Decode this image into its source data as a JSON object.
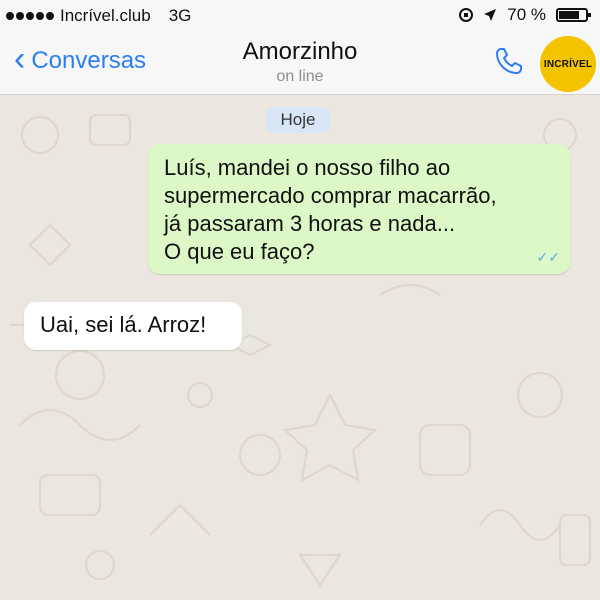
{
  "status_bar": {
    "carrier": "Incrível.club",
    "network": "3G",
    "battery": "70 %"
  },
  "header": {
    "back_label": "Conversas",
    "contact_name": "Amorzinho",
    "contact_status": "on line",
    "logo_text": "INCRÍVEL",
    "call_icon": "phone-icon"
  },
  "chat": {
    "date_label": "Hoje",
    "messages": [
      {
        "direction": "outgoing",
        "lines": [
          "Luís, mandei o nosso filho ao",
          "supermercado comprar macarrão,",
          "já passaram 3 horas e nada...",
          "O que eu faço?"
        ],
        "read_ticks": "✓✓"
      },
      {
        "direction": "incoming",
        "text": "Uai, sei lá. Arroz!"
      }
    ]
  },
  "colors": {
    "accent": "#2b7ef1",
    "outgoing_bubble": "#dcf8c6",
    "incoming_bubble": "#ffffff",
    "chat_background": "#ebe6df",
    "logo_badge": "#f4c400"
  }
}
